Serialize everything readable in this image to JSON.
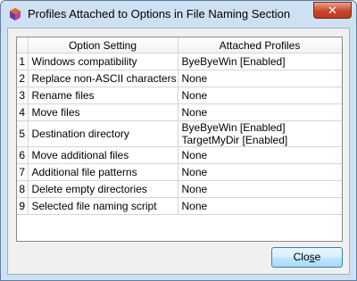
{
  "window": {
    "title": "Profiles Attached to Options in File Naming Section",
    "close_glyph": "✕"
  },
  "table": {
    "headers": [
      "",
      "Option Setting",
      "Attached Profiles"
    ],
    "rows": [
      {
        "num": "1",
        "option": "Windows compatibility",
        "profiles": [
          "ByeByeWin [Enabled]"
        ]
      },
      {
        "num": "2",
        "option": "Replace non-ASCII characters",
        "profiles": [
          "None"
        ]
      },
      {
        "num": "3",
        "option": "Rename files",
        "profiles": [
          "None"
        ]
      },
      {
        "num": "4",
        "option": "Move files",
        "profiles": [
          "None"
        ]
      },
      {
        "num": "5",
        "option": "Destination directory",
        "profiles": [
          "ByeByeWin [Enabled]",
          "TargetMyDir [Enabled]"
        ]
      },
      {
        "num": "6",
        "option": "Move additional files",
        "profiles": [
          "None"
        ]
      },
      {
        "num": "7",
        "option": "Additional file patterns",
        "profiles": [
          "None"
        ]
      },
      {
        "num": "8",
        "option": "Delete empty directories",
        "profiles": [
          "None"
        ]
      },
      {
        "num": "9",
        "option": "Selected file naming script",
        "profiles": [
          "None"
        ]
      }
    ]
  },
  "buttons": {
    "close_pre": "Clo",
    "close_mnemonic": "s",
    "close_post": "e"
  },
  "colors": {
    "selection_accent": "#3c7fb1",
    "titlebar": "#cfe0f3",
    "close_button": "#c8462b"
  },
  "icons": {
    "app": "picard-hexagon-icon",
    "close": "close-icon"
  }
}
